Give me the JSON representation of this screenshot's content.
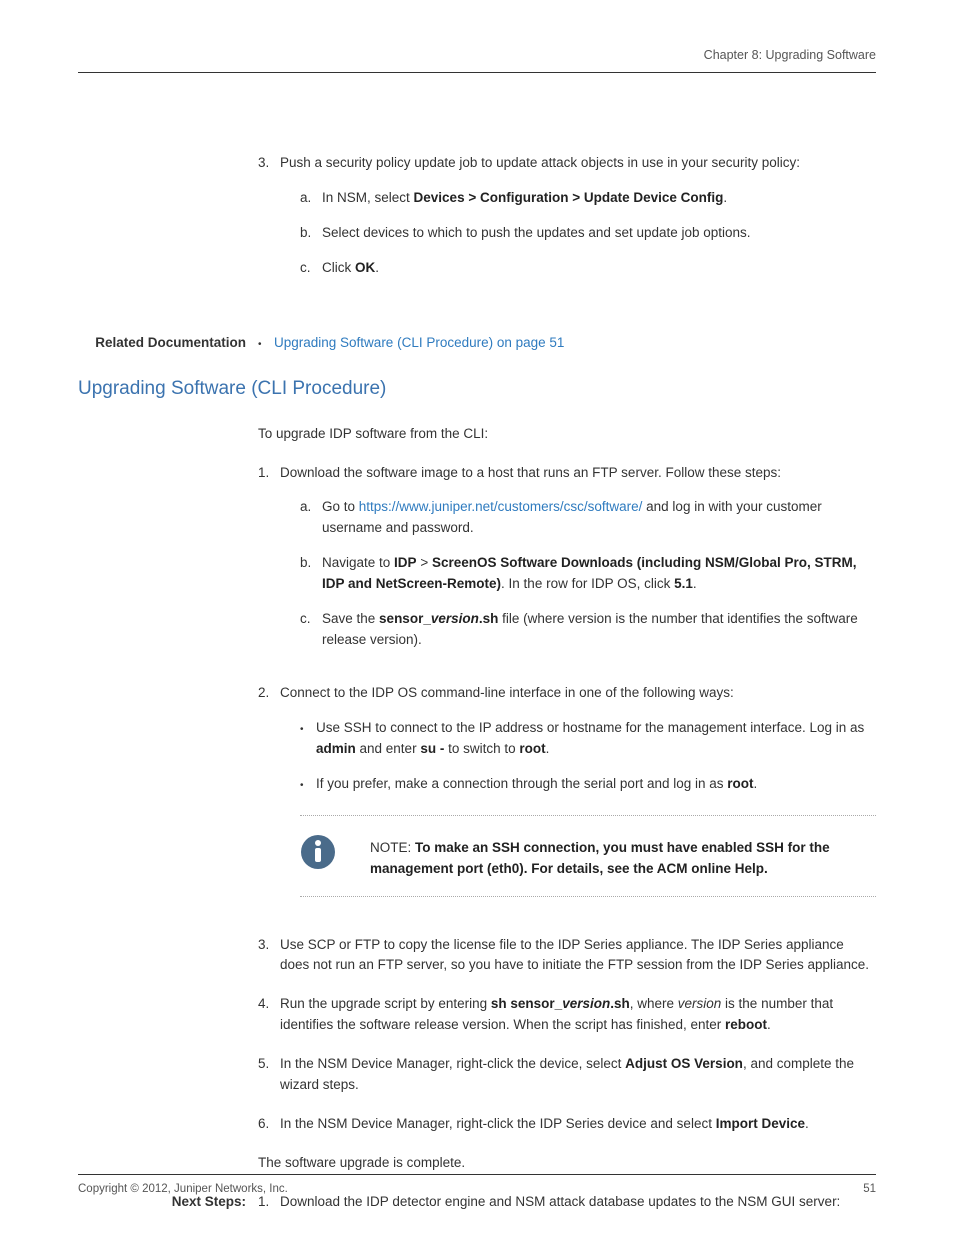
{
  "header": {
    "chapter": "Chapter 8: Upgrading Software"
  },
  "step3": {
    "num": "3.",
    "text": "Push a security policy update job to update attack objects in use in your security policy:",
    "a_num": "a.",
    "a_pre": "In NSM, select ",
    "a_bold": "Devices > Configuration > Update Device Config",
    "a_post": ".",
    "b_num": "b.",
    "b_text": "Select devices to which to push the updates and set update job options.",
    "c_num": "c.",
    "c_pre": "Click ",
    "c_bold": "OK",
    "c_post": "."
  },
  "related": {
    "label": "Related Documentation",
    "link": "Upgrading Software (CLI Procedure) on page 51"
  },
  "section": {
    "title": "Upgrading Software (CLI Procedure)",
    "intro": "To upgrade IDP software from the CLI:"
  },
  "s1": {
    "num": "1.",
    "text": "Download the software image to a host that runs an FTP server. Follow these steps:",
    "a_num": "a.",
    "a_pre": "Go to ",
    "a_link": "https://www.juniper.net/customers/csc/software/",
    "a_post": " and log in with your customer username and password.",
    "b_num": "b.",
    "b_pre": "Navigate to ",
    "b_bold1": "IDP",
    "b_mid1": " > ",
    "b_bold2": "ScreenOS Software Downloads (including NSM/Global Pro, STRM, IDP and NetScreen-Remote)",
    "b_mid2": ". In the row for IDP OS, click ",
    "b_bold3": "5.1",
    "b_post": ".",
    "c_num": "c.",
    "c_pre": "Save the ",
    "c_b1": "sensor_",
    "c_i": "version",
    "c_b2": ".sh",
    "c_post": " file (where version is the number that identifies the software release version)."
  },
  "s2": {
    "num": "2.",
    "text": "Connect to the IDP OS command-line interface in one of the following ways:",
    "bul1_pre": "Use SSH to connect to the IP address or hostname for the management interface. Log in as ",
    "bul1_b1": "admin",
    "bul1_mid": " and enter ",
    "bul1_b2": "su -",
    "bul1_mid2": " to switch to ",
    "bul1_b3": "root",
    "bul1_post": ".",
    "bul2_pre": "If you prefer, make a connection through the serial port and log in as ",
    "bul2_b": "root",
    "bul2_post": "."
  },
  "note": {
    "prefix": "NOTE:  ",
    "text": "To make an SSH connection, you must have enabled SSH for the management port (eth0). For details, see the ACM online Help."
  },
  "s3": {
    "num": "3.",
    "text": "Use SCP or FTP to copy the license file to the IDP Series appliance. The IDP Series appliance does not run an FTP server, so you have to initiate the FTP session from the IDP Series appliance."
  },
  "s4": {
    "num": "4.",
    "pre": "Run the upgrade script by entering ",
    "b1": "sh sensor_",
    "i1": "version",
    "b2": ".sh",
    "mid": ", where ",
    "i2": "version",
    "mid2": " is the number that identifies the software release version. When the script has finished, enter ",
    "b3": "reboot",
    "post": "."
  },
  "s5": {
    "num": "5.",
    "pre": "In the NSM Device Manager, right-click the device, select ",
    "b": "Adjust OS Version",
    "post": ", and complete the wizard steps."
  },
  "s6": {
    "num": "6.",
    "pre": "In the NSM Device Manager, right-click the IDP Series device and select ",
    "b": "Import Device",
    "post": "."
  },
  "complete": "The software upgrade is complete.",
  "next": {
    "label": "Next Steps:",
    "num": "1.",
    "text": "Download the IDP detector engine and NSM attack database updates to the NSM GUI server:"
  },
  "footer": {
    "copyright": "Copyright © 2012, Juniper Networks, Inc.",
    "page": "51"
  }
}
